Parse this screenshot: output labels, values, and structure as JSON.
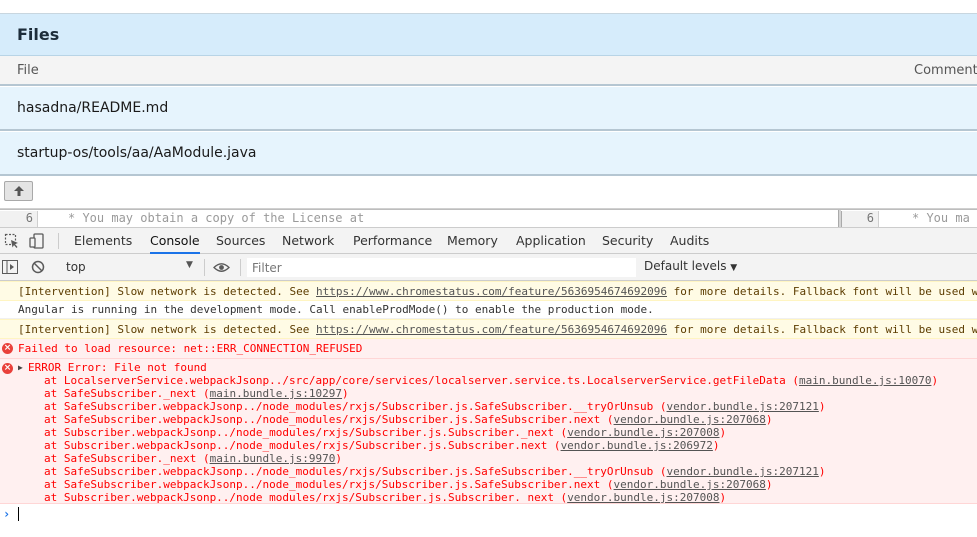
{
  "app": {
    "files_title": "Files",
    "columns": {
      "file": "File",
      "comment": "Comment"
    },
    "rows": [
      {
        "name": "hasadna/README.md"
      },
      {
        "name": "startup-os/tools/aa/AaModule.java"
      }
    ],
    "diff": {
      "left_line": "6",
      "left_code": " * You may obtain a copy of the License at",
      "right_line": "6",
      "right_code": " * You ma"
    }
  },
  "devtools": {
    "tabs": [
      {
        "label": "Elements"
      },
      {
        "label": "Console"
      },
      {
        "label": "Sources"
      },
      {
        "label": "Network"
      },
      {
        "label": "Performance"
      },
      {
        "label": "Memory"
      },
      {
        "label": "Application"
      },
      {
        "label": "Security"
      },
      {
        "label": "Audits"
      }
    ],
    "active_tab": "Console",
    "context": "top",
    "filter_placeholder": "Filter",
    "levels_label": "Default levels",
    "accent": "#1a73e8"
  },
  "console": {
    "warn1": {
      "pre": "[Intervention] Slow network is detected. See ",
      "link": "https://www.chromestatus.com/feature/5636954674692096",
      "post": " for more details. Fallback font will be used w"
    },
    "info1": "Angular is running in the development mode. Call enableProdMode() to enable the production mode.",
    "warn2": {
      "pre": "[Intervention] Slow network is detected. See ",
      "link": "https://www.chromestatus.com/feature/5636954674692096",
      "post": " for more details. Fallback font will be used w"
    },
    "err1": "Failed to load resource: net::ERR_CONNECTION_REFUSED",
    "err2": {
      "head": "ERROR Error: File not found",
      "stack": [
        {
          "text": "at LocalserverService.webpackJsonp../src/app/core/services/localserver.service.ts.LocalserverService.getFileData (",
          "link": "main.bundle.js:10070",
          "tail": ")"
        },
        {
          "text": "at SafeSubscriber._next (",
          "link": "main.bundle.js:10297",
          "tail": ")"
        },
        {
          "text": "at SafeSubscriber.webpackJsonp../node_modules/rxjs/Subscriber.js.SafeSubscriber.__tryOrUnsub (",
          "link": "vendor.bundle.js:207121",
          "tail": ")"
        },
        {
          "text": "at SafeSubscriber.webpackJsonp../node_modules/rxjs/Subscriber.js.SafeSubscriber.next (",
          "link": "vendor.bundle.js:207068",
          "tail": ")"
        },
        {
          "text": "at Subscriber.webpackJsonp../node_modules/rxjs/Subscriber.js.Subscriber._next (",
          "link": "vendor.bundle.js:207008",
          "tail": ")"
        },
        {
          "text": "at Subscriber.webpackJsonp../node_modules/rxjs/Subscriber.js.Subscriber.next (",
          "link": "vendor.bundle.js:206972",
          "tail": ")"
        },
        {
          "text": "at SafeSubscriber._next (",
          "link": "main.bundle.js:9970",
          "tail": ")"
        },
        {
          "text": "at SafeSubscriber.webpackJsonp../node_modules/rxjs/Subscriber.js.SafeSubscriber.__tryOrUnsub (",
          "link": "vendor.bundle.js:207121",
          "tail": ")"
        },
        {
          "text": "at SafeSubscriber.webpackJsonp../node_modules/rxjs/Subscriber.js.SafeSubscriber.next (",
          "link": "vendor.bundle.js:207068",
          "tail": ")"
        },
        {
          "text": "at Subscriber.webpackJsonp../node_modules/rxjs/Subscriber.js.Subscriber._next (",
          "link": "vendor.bundle.js:207008",
          "tail": ")"
        }
      ]
    },
    "prompt_symbol": "›"
  }
}
